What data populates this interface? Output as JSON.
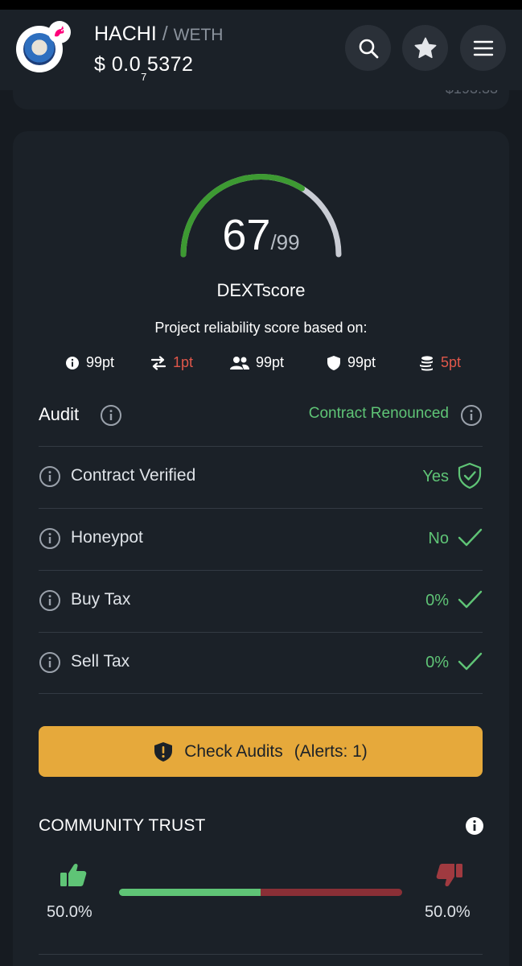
{
  "header": {
    "token_symbol": "HACHI",
    "separator": "/",
    "quote_symbol": "WETH",
    "price_prefix": "$ 0.0",
    "price_zeros": "7",
    "price_digits": "5372",
    "icons": [
      "search-icon",
      "star-icon",
      "menu-icon"
    ]
  },
  "previous_card": {
    "partial_value": "$193.33"
  },
  "score": {
    "value": "67",
    "max": "/99",
    "fraction": 0.677,
    "label": "DEXTscore",
    "description": "Project reliability score based on:",
    "colors": {
      "good": "#3d9a32",
      "rest": "#c9ccd4"
    },
    "metrics": [
      {
        "icon": "info-icon",
        "value": "99pt",
        "color": "#ffffff"
      },
      {
        "icon": "transactions-icon",
        "value": "1pt",
        "color": "#e0574a"
      },
      {
        "icon": "users-icon",
        "value": "99pt",
        "color": "#ffffff"
      },
      {
        "icon": "shield-icon",
        "value": "99pt",
        "color": "#ffffff"
      },
      {
        "icon": "coins-icon",
        "value": "5pt",
        "color": "#e0574a"
      }
    ]
  },
  "audit": {
    "title": "Audit",
    "renounced": "Contract Renounced",
    "rows": [
      {
        "label": "Contract Verified",
        "value": "Yes",
        "icon": "shield-check-icon"
      },
      {
        "label": "Honeypot",
        "value": "No",
        "icon": "check-icon"
      },
      {
        "label": "Buy Tax",
        "value": "0%",
        "icon": "check-icon"
      },
      {
        "label": "Sell Tax",
        "value": "0%",
        "icon": "check-icon"
      }
    ]
  },
  "check_audits": {
    "label": "Check Audits",
    "alerts": "(Alerts: 1)"
  },
  "community": {
    "title": "COMMUNITY TRUST",
    "up_percent": "50.0%",
    "down_percent": "50.0%",
    "up_fraction": 0.5,
    "colors": {
      "up": "#5fc476",
      "down": "#8a2f36"
    }
  }
}
